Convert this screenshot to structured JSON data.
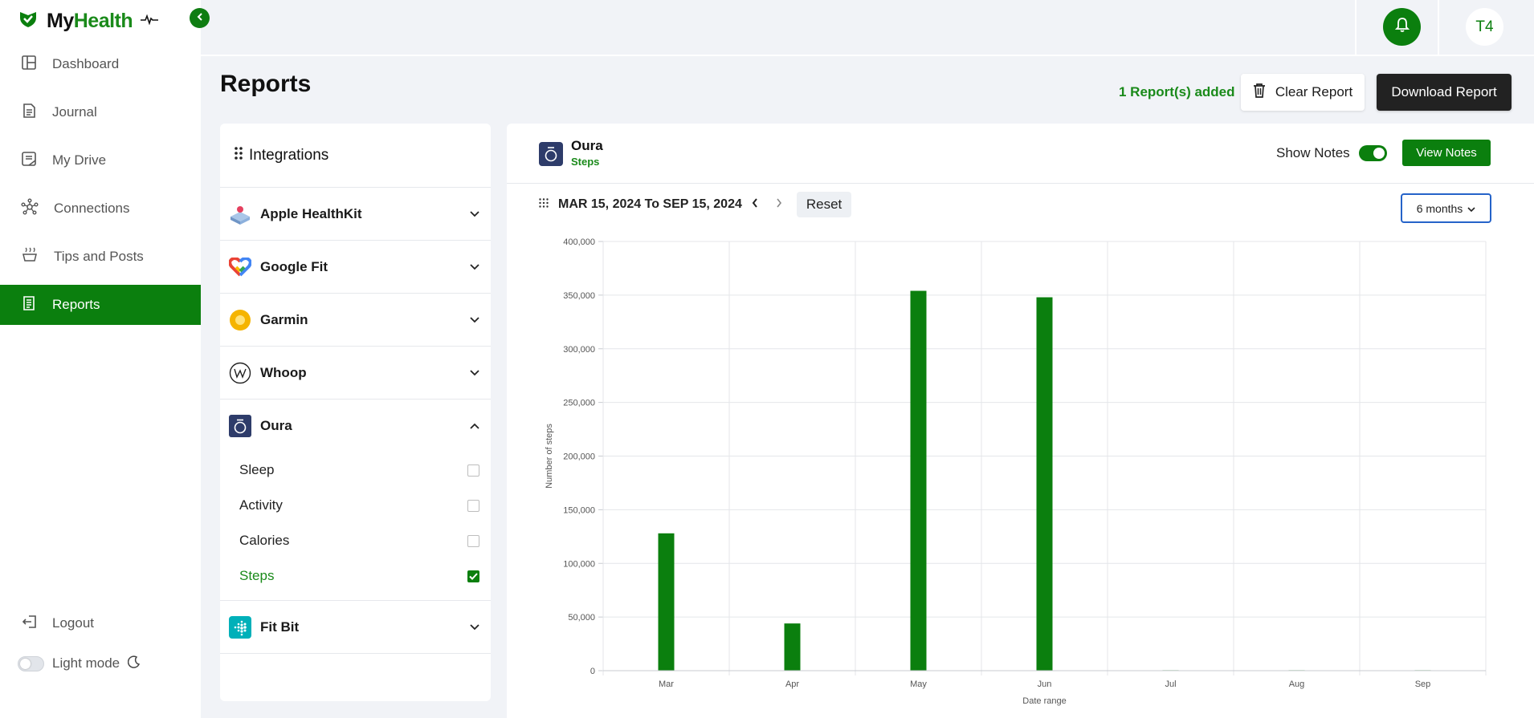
{
  "app": {
    "logo_text_a": "My",
    "logo_text_b": "Health"
  },
  "sidebar": {
    "items": [
      {
        "label": "Dashboard",
        "icon": "dashboard-icon"
      },
      {
        "label": "Journal",
        "icon": "journal-icon"
      },
      {
        "label": "My Drive",
        "icon": "drive-icon"
      },
      {
        "label": "Connections",
        "icon": "connections-icon"
      },
      {
        "label": "Tips and Posts",
        "icon": "tips-icon"
      },
      {
        "label": "Reports",
        "icon": "reports-icon",
        "active": true
      }
    ],
    "logout": "Logout",
    "light_mode": "Light mode"
  },
  "topbar": {
    "avatar_initials": "T4"
  },
  "page": {
    "title": "Reports",
    "added_text": "1 Report(s) added",
    "clear_label": "Clear Report",
    "download_label": "Download Report"
  },
  "integrations": {
    "title": "Integrations",
    "providers": [
      {
        "name": "Apple HealthKit",
        "expanded": false
      },
      {
        "name": "Google Fit",
        "expanded": false
      },
      {
        "name": "Garmin",
        "expanded": false
      },
      {
        "name": "Whoop",
        "expanded": false
      },
      {
        "name": "Oura",
        "expanded": true,
        "options": [
          {
            "label": "Sleep",
            "checked": false
          },
          {
            "label": "Activity",
            "checked": false
          },
          {
            "label": "Calories",
            "checked": false
          },
          {
            "label": "Steps",
            "checked": true
          }
        ]
      },
      {
        "name": "Fit Bit",
        "expanded": false
      }
    ]
  },
  "report": {
    "source": "Oura",
    "metric": "Steps",
    "show_notes_label": "Show Notes",
    "show_notes_on": true,
    "view_notes_label": "View Notes",
    "range_text": "MAR 15, 2024 To SEP 15, 2024",
    "reset_label": "Reset",
    "period_label": "6 months"
  },
  "colors": {
    "brand_green": "#0b7f0e",
    "bar_green": "#0b7f0e"
  },
  "chart_data": {
    "type": "bar",
    "categories": [
      "Mar",
      "Apr",
      "May",
      "Jun",
      "Jul",
      "Aug",
      "Sep"
    ],
    "values": [
      128000,
      44000,
      354000,
      348000,
      0,
      0,
      0
    ],
    "xlabel": "Date range",
    "ylabel": "Number of steps",
    "ylim": [
      0,
      400000
    ],
    "yticks": [
      "0",
      "50,000",
      "100,000",
      "150,000",
      "200,000",
      "250,000",
      "300,000",
      "350,000",
      "400,000"
    ],
    "grid": true
  }
}
